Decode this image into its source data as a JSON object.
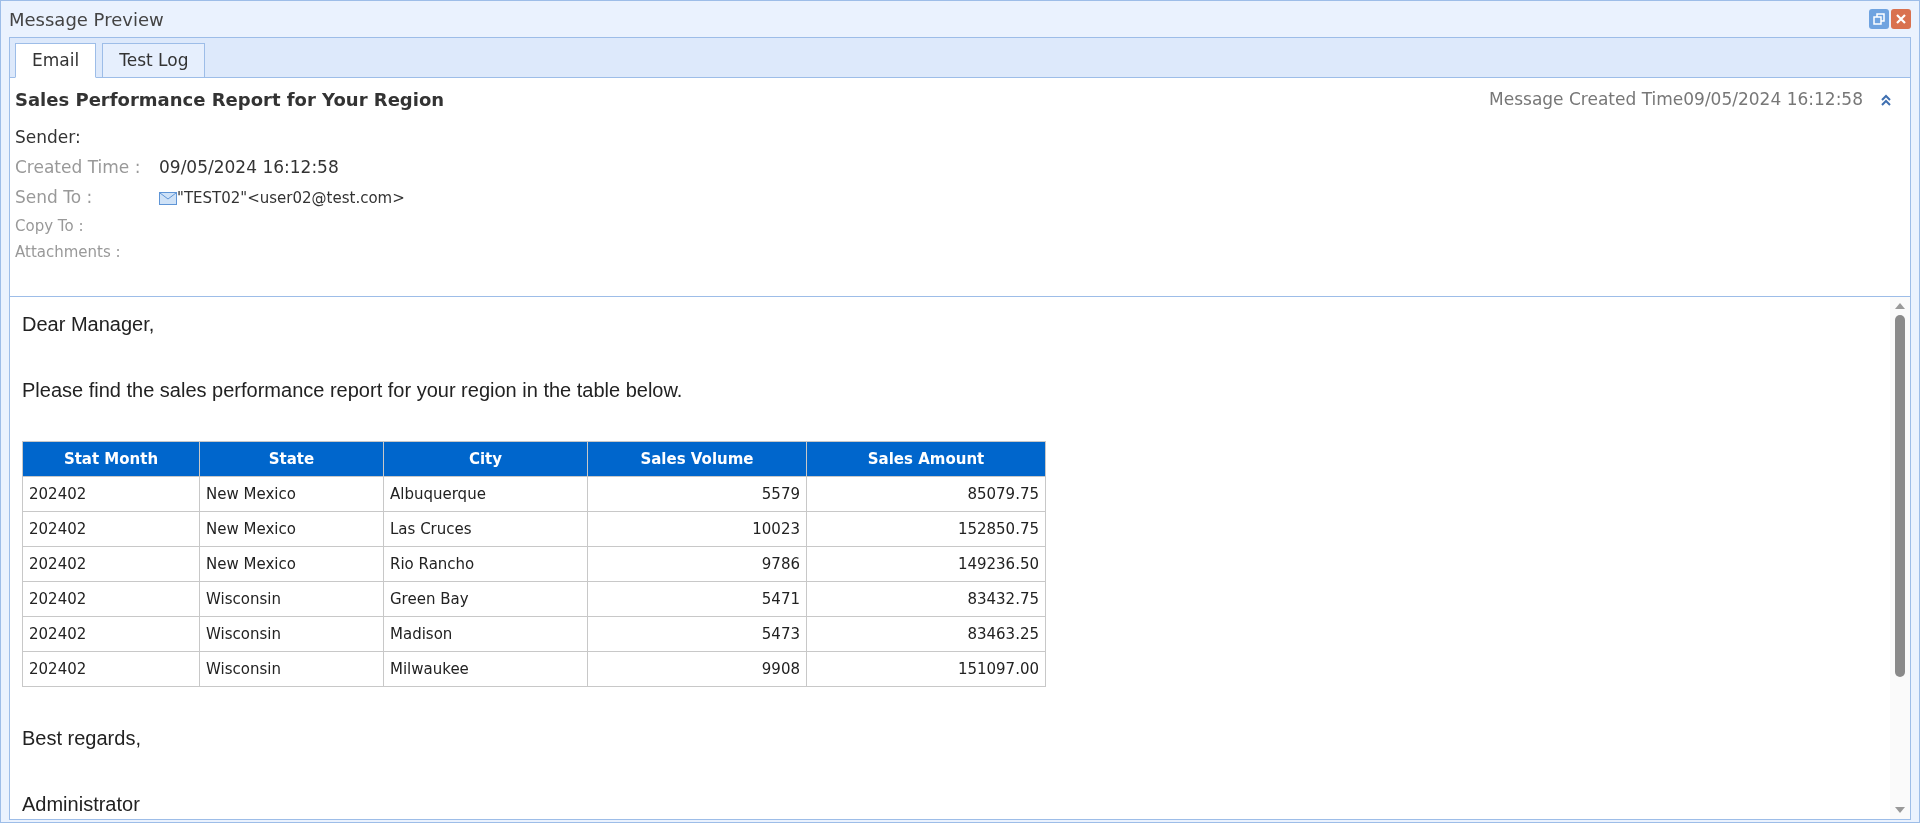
{
  "window": {
    "title": "Message Preview"
  },
  "tabs": [
    {
      "label": "Email",
      "selected": true
    },
    {
      "label": "Test Log",
      "selected": false
    }
  ],
  "header": {
    "subject": "Sales Performance Report for Your Region",
    "created_label": "Message Created Time",
    "created_value": "09/05/2024 16:12:58",
    "expanded": true,
    "fields": [
      {
        "label": "Sender:",
        "kind": "sender"
      },
      {
        "label": "Created Time :",
        "value": "09/05/2024 16:12:58",
        "kind": "text"
      },
      {
        "label": "Send To :",
        "value": "\"TEST02\"<user02@test.com>",
        "kind": "address"
      },
      {
        "label": "Copy To :",
        "kind": "text"
      },
      {
        "label": "Attachments :",
        "kind": "text"
      }
    ]
  },
  "body": {
    "greeting": "Dear Manager,",
    "intro": "Please find the sales performance report for your region in the table below.",
    "table": {
      "columns": [
        "Stat Month",
        "State",
        "City",
        "Sales Volume",
        "Sales Amount"
      ],
      "rows": [
        [
          "202402",
          "New Mexico",
          "Albuquerque",
          "5579",
          "85079.75"
        ],
        [
          "202402",
          "New Mexico",
          "Las Cruces",
          "10023",
          "152850.75"
        ],
        [
          "202402",
          "New Mexico",
          "Rio Rancho",
          "9786",
          "149236.50"
        ],
        [
          "202402",
          "Wisconsin",
          "Green Bay",
          "5471",
          "83432.75"
        ],
        [
          "202402",
          "Wisconsin",
          "Madison",
          "5473",
          "83463.25"
        ],
        [
          "202402",
          "Wisconsin",
          "Milwaukee",
          "9908",
          "151097.00"
        ]
      ]
    },
    "closing": "Best regards,",
    "signature": "Administrator"
  }
}
